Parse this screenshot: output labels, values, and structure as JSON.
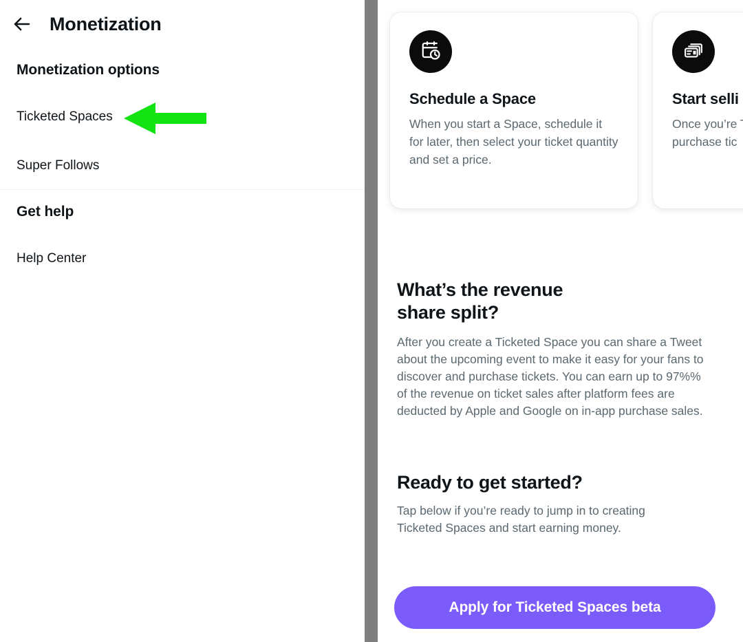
{
  "left_panel": {
    "back_icon": "arrow-left-icon",
    "title": "Monetization",
    "sections": [
      {
        "heading": "Monetization options",
        "items": [
          {
            "label": "Ticketed Spaces"
          },
          {
            "label": "Super Follows"
          }
        ]
      },
      {
        "heading": "Get help",
        "items": [
          {
            "label": "Help Center"
          }
        ]
      }
    ]
  },
  "annotation": {
    "type": "arrow-left-annotation",
    "color": "#13E213",
    "points_at": "Ticketed Spaces"
  },
  "right_panel": {
    "cards": [
      {
        "icon": "calendar-clock-icon",
        "title": "Schedule a Space",
        "body": "When you start a Space, schedule it for later, then select your ticket quantity and set a price."
      },
      {
        "icon": "ticket-cards-icon",
        "title": "Start selli",
        "body": "Once you’re Ticketed Sp all of your fo purchase tic"
      }
    ],
    "sections": [
      {
        "title": "What’s the revenue share split?",
        "text": "After you create a Ticketed Space you can share a Tweet about the upcoming event to make it easy for your fans to discover and purchase tickets. You can earn up to 97%% of the revenue on ticket sales after platform fees are deducted by Apple and Google on in-app purchase sales."
      },
      {
        "title": "Ready to get started?",
        "text": "Tap below if you’re ready to jump in to creating Ticketed Spaces and start earning money."
      }
    ],
    "cta": {
      "label": "Apply for Ticketed Spaces beta",
      "color": "#7B5CFA"
    }
  },
  "colors": {
    "text_primary": "#0F1419",
    "text_secondary": "#5B6870",
    "divider": "#EFF3F4",
    "separator_strip": "#7F7F7F",
    "icon_circle": "#0B0B0B"
  }
}
